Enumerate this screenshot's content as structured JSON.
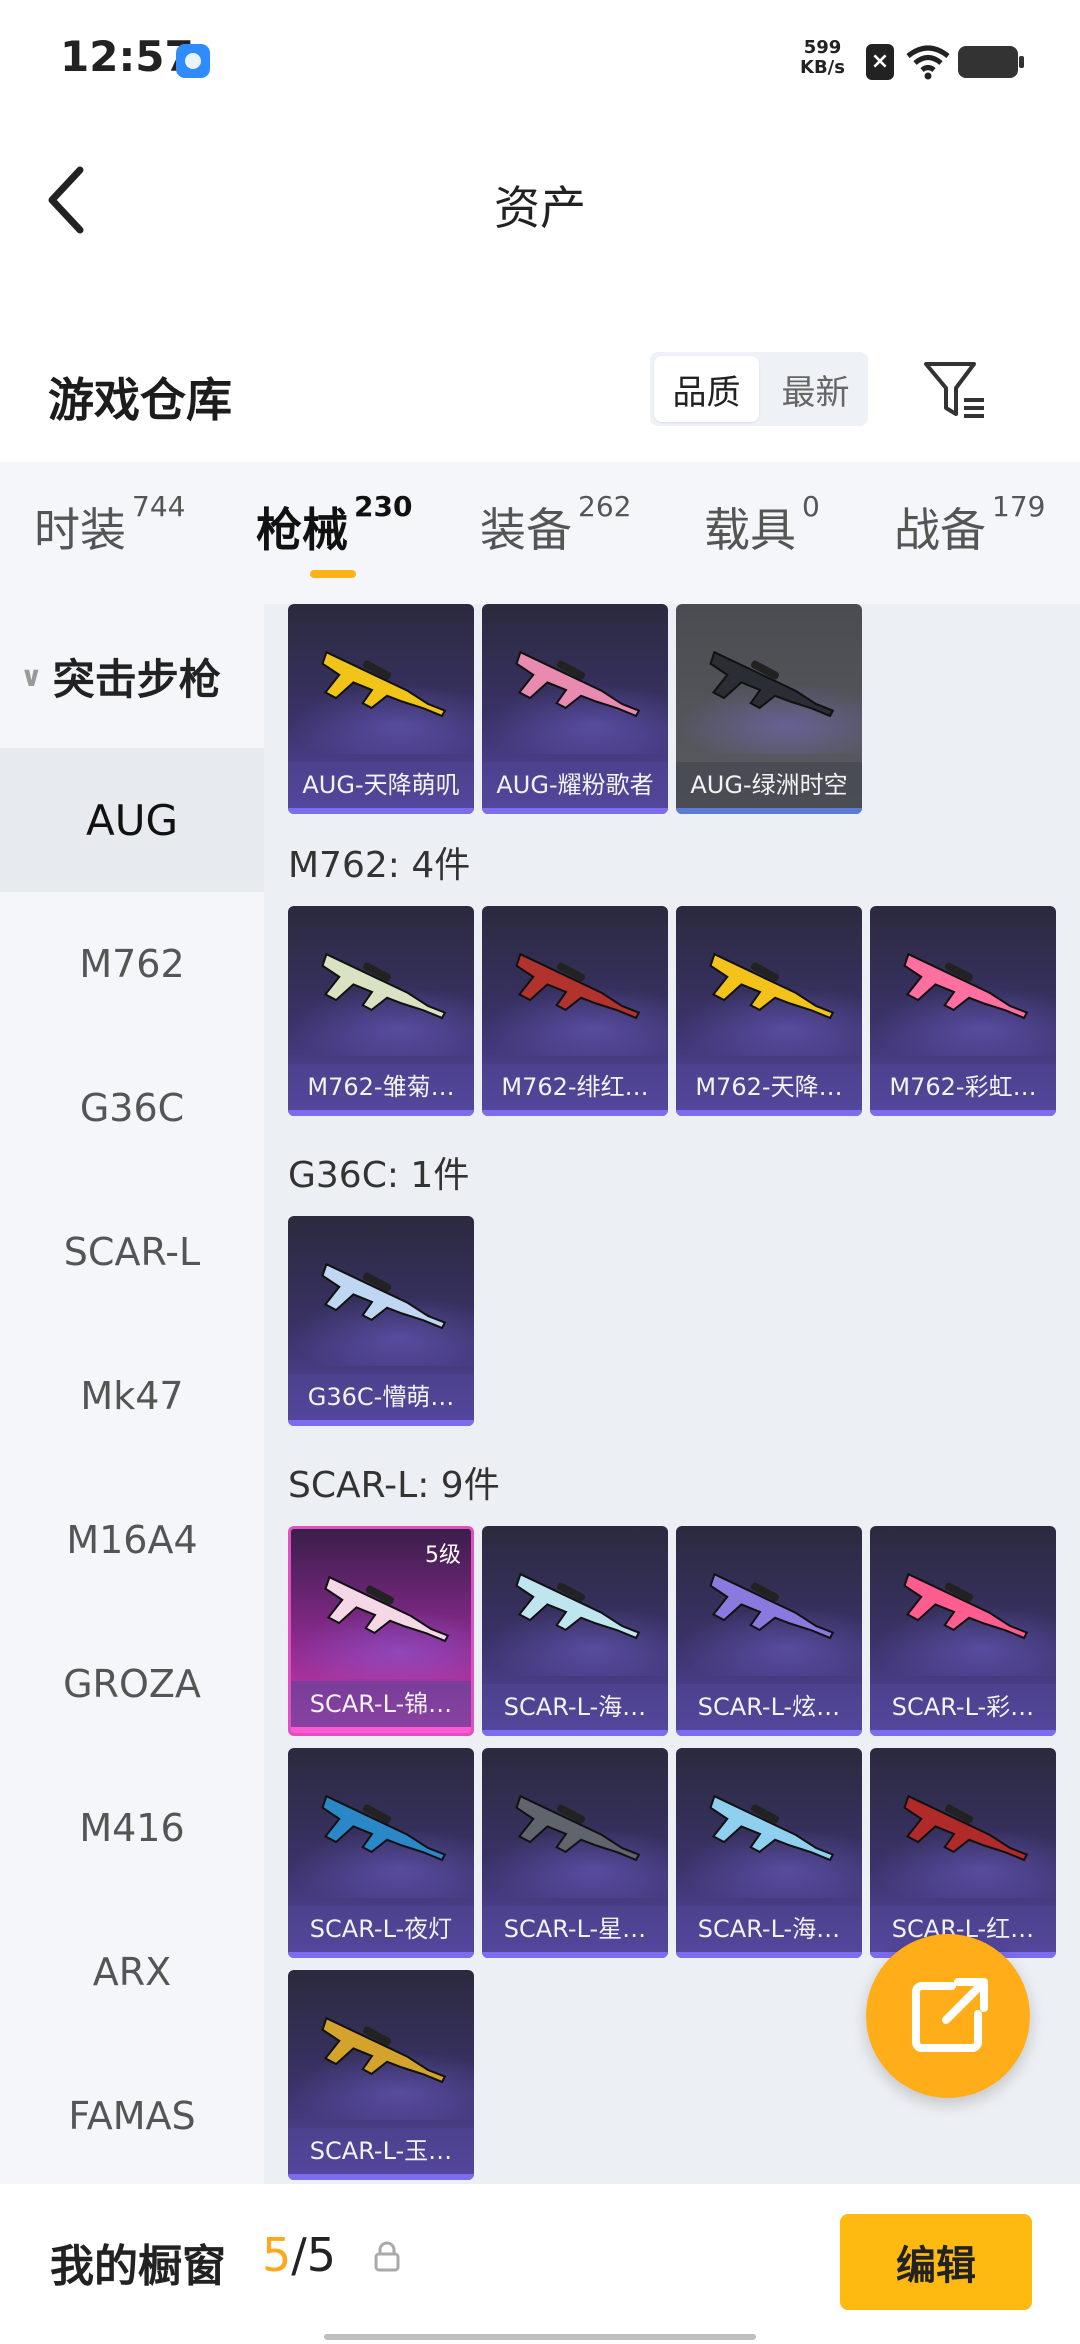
{
  "status_bar": {
    "time": "12:57",
    "net_speed_value": "599",
    "net_speed_unit": "KB/s"
  },
  "header": {
    "title": "资产"
  },
  "subheader": {
    "title": "游戏仓库",
    "sort_options": [
      "品质",
      "最新"
    ],
    "sort_active": "品质"
  },
  "tabs": [
    {
      "label": "时装",
      "count": "744"
    },
    {
      "label": "枪械",
      "count": "230"
    },
    {
      "label": "装备",
      "count": "262"
    },
    {
      "label": "载具",
      "count": "0"
    },
    {
      "label": "战备",
      "count": "179"
    }
  ],
  "sidebar": {
    "group": "突击步枪",
    "items": [
      "AUG",
      "M762",
      "G36C",
      "SCAR-L",
      "Mk47",
      "M16A4",
      "GROZA",
      "M416",
      "ARX",
      "FAMAS"
    ],
    "active": "AUG"
  },
  "content": {
    "aug_cards": [
      {
        "label": "AUG-天降萌叽",
        "color": "#f0c419",
        "style": "normal"
      },
      {
        "label": "AUG-耀粉歌者",
        "color": "#e98ab0",
        "style": "normal"
      },
      {
        "label": "AUG-绿洲时空",
        "color": "#2a2d33",
        "style": "gray"
      }
    ],
    "m762_label": "M762: 4件",
    "m762_cards": [
      {
        "label": "M762-雏菊…",
        "color": "#d9e3c3"
      },
      {
        "label": "M762-绯红…",
        "color": "#b2322d"
      },
      {
        "label": "M762-天降…",
        "color": "#f3c31c"
      },
      {
        "label": "M762-彩虹…",
        "color": "#ff6f9f"
      }
    ],
    "g36c_label": "G36C: 1件",
    "g36c_cards": [
      {
        "label": "G36C-懵萌…",
        "color": "#bfd7f2"
      }
    ],
    "scar_label": "SCAR-L: 9件",
    "scar_cards": [
      {
        "label": "SCAR-L-锦…",
        "color": "#f5d7e6",
        "style": "pink",
        "level": "5级"
      },
      {
        "label": "SCAR-L-海…",
        "color": "#bfe6ef"
      },
      {
        "label": "SCAR-L-炫…",
        "color": "#8a7ae0"
      },
      {
        "label": "SCAR-L-彩…",
        "color": "#ff5d8f"
      },
      {
        "label": "SCAR-L-夜灯",
        "color": "#2a88c8"
      },
      {
        "label": "SCAR-L-星…",
        "color": "#60656d"
      },
      {
        "label": "SCAR-L-海…",
        "color": "#8fd0f0"
      },
      {
        "label": "SCAR-L-红…",
        "color": "#b02a2a"
      },
      {
        "label": "SCAR-L-玉…",
        "color": "#d4a32c"
      }
    ]
  },
  "bottom_bar": {
    "title": "我的橱窗",
    "count_current": "5",
    "count_sep_total": "/5",
    "edit_label": "编辑"
  },
  "colors": {
    "accent": "#ffb319",
    "edit_button": "#ffba12",
    "fab": "#ffae1a"
  }
}
